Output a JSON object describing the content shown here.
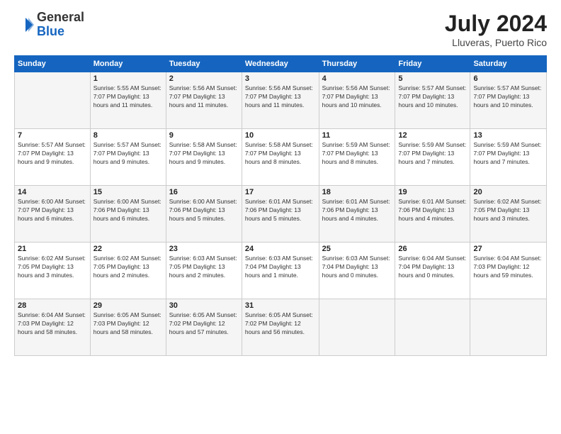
{
  "header": {
    "logo_general": "General",
    "logo_blue": "Blue",
    "month_year": "July 2024",
    "location": "Lluveras, Puerto Rico"
  },
  "weekdays": [
    "Sunday",
    "Monday",
    "Tuesday",
    "Wednesday",
    "Thursday",
    "Friday",
    "Saturday"
  ],
  "rows": [
    [
      {
        "day": "",
        "info": ""
      },
      {
        "day": "1",
        "info": "Sunrise: 5:55 AM\nSunset: 7:07 PM\nDaylight: 13 hours\nand 11 minutes."
      },
      {
        "day": "2",
        "info": "Sunrise: 5:56 AM\nSunset: 7:07 PM\nDaylight: 13 hours\nand 11 minutes."
      },
      {
        "day": "3",
        "info": "Sunrise: 5:56 AM\nSunset: 7:07 PM\nDaylight: 13 hours\nand 11 minutes."
      },
      {
        "day": "4",
        "info": "Sunrise: 5:56 AM\nSunset: 7:07 PM\nDaylight: 13 hours\nand 10 minutes."
      },
      {
        "day": "5",
        "info": "Sunrise: 5:57 AM\nSunset: 7:07 PM\nDaylight: 13 hours\nand 10 minutes."
      },
      {
        "day": "6",
        "info": "Sunrise: 5:57 AM\nSunset: 7:07 PM\nDaylight: 13 hours\nand 10 minutes."
      }
    ],
    [
      {
        "day": "7",
        "info": "Sunrise: 5:57 AM\nSunset: 7:07 PM\nDaylight: 13 hours\nand 9 minutes."
      },
      {
        "day": "8",
        "info": "Sunrise: 5:57 AM\nSunset: 7:07 PM\nDaylight: 13 hours\nand 9 minutes."
      },
      {
        "day": "9",
        "info": "Sunrise: 5:58 AM\nSunset: 7:07 PM\nDaylight: 13 hours\nand 9 minutes."
      },
      {
        "day": "10",
        "info": "Sunrise: 5:58 AM\nSunset: 7:07 PM\nDaylight: 13 hours\nand 8 minutes."
      },
      {
        "day": "11",
        "info": "Sunrise: 5:59 AM\nSunset: 7:07 PM\nDaylight: 13 hours\nand 8 minutes."
      },
      {
        "day": "12",
        "info": "Sunrise: 5:59 AM\nSunset: 7:07 PM\nDaylight: 13 hours\nand 7 minutes."
      },
      {
        "day": "13",
        "info": "Sunrise: 5:59 AM\nSunset: 7:07 PM\nDaylight: 13 hours\nand 7 minutes."
      }
    ],
    [
      {
        "day": "14",
        "info": "Sunrise: 6:00 AM\nSunset: 7:07 PM\nDaylight: 13 hours\nand 6 minutes."
      },
      {
        "day": "15",
        "info": "Sunrise: 6:00 AM\nSunset: 7:06 PM\nDaylight: 13 hours\nand 6 minutes."
      },
      {
        "day": "16",
        "info": "Sunrise: 6:00 AM\nSunset: 7:06 PM\nDaylight: 13 hours\nand 5 minutes."
      },
      {
        "day": "17",
        "info": "Sunrise: 6:01 AM\nSunset: 7:06 PM\nDaylight: 13 hours\nand 5 minutes."
      },
      {
        "day": "18",
        "info": "Sunrise: 6:01 AM\nSunset: 7:06 PM\nDaylight: 13 hours\nand 4 minutes."
      },
      {
        "day": "19",
        "info": "Sunrise: 6:01 AM\nSunset: 7:06 PM\nDaylight: 13 hours\nand 4 minutes."
      },
      {
        "day": "20",
        "info": "Sunrise: 6:02 AM\nSunset: 7:05 PM\nDaylight: 13 hours\nand 3 minutes."
      }
    ],
    [
      {
        "day": "21",
        "info": "Sunrise: 6:02 AM\nSunset: 7:05 PM\nDaylight: 13 hours\nand 3 minutes."
      },
      {
        "day": "22",
        "info": "Sunrise: 6:02 AM\nSunset: 7:05 PM\nDaylight: 13 hours\nand 2 minutes."
      },
      {
        "day": "23",
        "info": "Sunrise: 6:03 AM\nSunset: 7:05 PM\nDaylight: 13 hours\nand 2 minutes."
      },
      {
        "day": "24",
        "info": "Sunrise: 6:03 AM\nSunset: 7:04 PM\nDaylight: 13 hours\nand 1 minute."
      },
      {
        "day": "25",
        "info": "Sunrise: 6:03 AM\nSunset: 7:04 PM\nDaylight: 13 hours\nand 0 minutes."
      },
      {
        "day": "26",
        "info": "Sunrise: 6:04 AM\nSunset: 7:04 PM\nDaylight: 13 hours\nand 0 minutes."
      },
      {
        "day": "27",
        "info": "Sunrise: 6:04 AM\nSunset: 7:03 PM\nDaylight: 12 hours\nand 59 minutes."
      }
    ],
    [
      {
        "day": "28",
        "info": "Sunrise: 6:04 AM\nSunset: 7:03 PM\nDaylight: 12 hours\nand 58 minutes."
      },
      {
        "day": "29",
        "info": "Sunrise: 6:05 AM\nSunset: 7:03 PM\nDaylight: 12 hours\nand 58 minutes."
      },
      {
        "day": "30",
        "info": "Sunrise: 6:05 AM\nSunset: 7:02 PM\nDaylight: 12 hours\nand 57 minutes."
      },
      {
        "day": "31",
        "info": "Sunrise: 6:05 AM\nSunset: 7:02 PM\nDaylight: 12 hours\nand 56 minutes."
      },
      {
        "day": "",
        "info": ""
      },
      {
        "day": "",
        "info": ""
      },
      {
        "day": "",
        "info": ""
      }
    ]
  ]
}
